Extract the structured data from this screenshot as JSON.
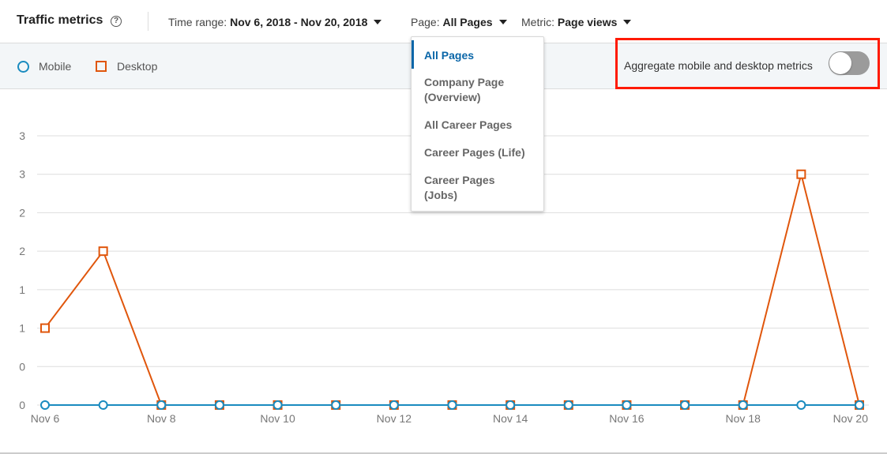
{
  "header": {
    "title": "Traffic metrics",
    "help_icon": "question-circle-icon",
    "time_range": {
      "label": "Time range:",
      "value": "Nov 6, 2018 - Nov 20, 2018"
    },
    "page": {
      "label": "Page:",
      "value": "All Pages"
    },
    "metric": {
      "label": "Metric:",
      "value": "Page views"
    }
  },
  "legend": {
    "mobile": "Mobile",
    "desktop": "Desktop"
  },
  "aggregate": {
    "label": "Aggregate mobile and desktop metrics",
    "enabled": false
  },
  "page_dropdown": {
    "selected": "All Pages",
    "options": [
      {
        "line1": "All Pages",
        "line2": ""
      },
      {
        "line1": "Company Page",
        "line2": "(Overview)"
      },
      {
        "line1": "All Career Pages",
        "line2": ""
      },
      {
        "line1": "Career Pages (Life)",
        "line2": ""
      },
      {
        "line1": "Career Pages",
        "line2": "(Jobs)"
      }
    ]
  },
  "colors": {
    "mobile": "#1a8bbf",
    "desktop": "#e0560c",
    "grid": "#dedede",
    "highlight_box": "#ff1a00",
    "selected_option": "#0a66a8"
  },
  "chart_data": {
    "type": "line",
    "title": "",
    "xlabel": "",
    "ylabel": "",
    "x": [
      "Nov 6",
      "Nov 7",
      "Nov 8",
      "Nov 9",
      "Nov 10",
      "Nov 11",
      "Nov 12",
      "Nov 13",
      "Nov 14",
      "Nov 15",
      "Nov 16",
      "Nov 17",
      "Nov 18",
      "Nov 19",
      "Nov 20"
    ],
    "x_tick_labels": [
      "Nov 6",
      "Nov 8",
      "Nov 10",
      "Nov 12",
      "Nov 14",
      "Nov 16",
      "Nov 18",
      "Nov 20"
    ],
    "y_ticks": [
      0,
      0.5,
      1,
      1.5,
      2,
      2.5,
      3,
      3.5
    ],
    "y_tick_labels": [
      "0",
      "0",
      "1",
      "1",
      "2",
      "2",
      "3",
      "3"
    ],
    "ylim": [
      0,
      3.5
    ],
    "grid": true,
    "legend_position": "top-left",
    "series": [
      {
        "name": "Mobile",
        "marker": "circle",
        "values": [
          0,
          0,
          0,
          0,
          0,
          0,
          0,
          0,
          0,
          0,
          0,
          0,
          0,
          0,
          0
        ]
      },
      {
        "name": "Desktop",
        "marker": "square",
        "values": [
          1,
          2,
          0,
          0,
          0,
          0,
          0,
          0,
          0,
          0,
          0,
          0,
          0,
          3,
          0
        ]
      }
    ]
  }
}
